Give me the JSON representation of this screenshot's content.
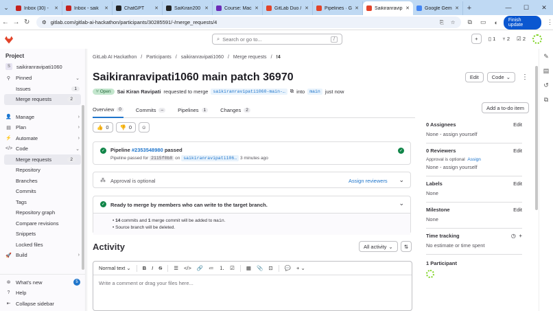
{
  "browser": {
    "tabs": [
      {
        "label": "Inbox (30) -",
        "color": "#c5221f"
      },
      {
        "label": "Inbox - saik",
        "color": "#c5221f"
      },
      {
        "label": "ChatGPT",
        "color": "#222222"
      },
      {
        "label": "SaiKiran200",
        "color": "#222222"
      },
      {
        "label": "Course: Mac",
        "color": "#6c2ab7"
      },
      {
        "label": "GitLab Duo /",
        "color": "#e24329"
      },
      {
        "label": "Pipelines · Gi",
        "color": "#e24329"
      },
      {
        "label": "Saikiranravip",
        "color": "#e24329"
      },
      {
        "label": "Google Gem",
        "color": "#4285f4"
      }
    ],
    "url": "gitlab.com/gitlab-ai-hackathon/participants/30285591/-/merge_requests/4",
    "finish_update": "Finish update"
  },
  "topbar": {
    "search_placeholder": "Search or go to...",
    "search_kbd": "/",
    "issues_count": "1",
    "mr_count": "2",
    "todo_count": "2"
  },
  "sidebar": {
    "project_heading": "Project",
    "project_initial": "S",
    "project_name": "saikiranravipati1060",
    "pinned": "Pinned",
    "pinned_items": [
      {
        "label": "Issues",
        "count": "1"
      },
      {
        "label": "Merge requests",
        "count": "2"
      }
    ],
    "groups": [
      {
        "label": "Manage",
        "icon": "manage-icon"
      },
      {
        "label": "Plan",
        "icon": "plan-icon"
      },
      {
        "label": "Automate",
        "icon": "automate-icon"
      },
      {
        "label": "Code",
        "icon": "code-icon"
      }
    ],
    "code_items": [
      {
        "label": "Merge requests",
        "count": "2"
      },
      {
        "label": "Repository"
      },
      {
        "label": "Branches"
      },
      {
        "label": "Commits"
      },
      {
        "label": "Tags"
      },
      {
        "label": "Repository graph"
      },
      {
        "label": "Compare revisions"
      },
      {
        "label": "Snippets"
      },
      {
        "label": "Locked files"
      }
    ],
    "build": "Build",
    "whats_new": "What's new",
    "whats_new_count": "5",
    "help": "Help",
    "collapse": "Collapse sidebar"
  },
  "breadcrumb": [
    "GitLab AI Hackathon",
    "Participants",
    "saikiranravipati1060",
    "Merge requests",
    "!4"
  ],
  "mr": {
    "title": "Saikiranravipati1060 main patch 36970",
    "status": "Open",
    "author": "Sai Kiran Ravipati",
    "requested_text": "requested to merge",
    "source_branch": "saikiranravipati1060-main-…",
    "into": "into",
    "target_branch": "main",
    "time": "just now",
    "edit": "Edit",
    "code": "Code"
  },
  "tabs": [
    {
      "label": "Overview",
      "count": "0"
    },
    {
      "label": "Commits",
      "count": "–"
    },
    {
      "label": "Pipelines",
      "count": "1"
    },
    {
      "label": "Changes",
      "count": "2"
    }
  ],
  "todo_button": "Add a to-do item",
  "reactions": {
    "thumbs_up": "0",
    "thumbs_down": "0"
  },
  "pipeline": {
    "label": "Pipeline",
    "id": "#2353548980",
    "status": "passed",
    "sub_prefix": "Pipeline passed for",
    "commit": "2115f0b8",
    "on": "on",
    "branch": "saikiranravipati106…",
    "time": "3 minutes ago"
  },
  "approval": {
    "text": "Approval is optional",
    "assign": "Assign reviewers"
  },
  "ready": {
    "text": "Ready to merge by members who can write to the target branch.",
    "commits_count": "14",
    "line1_mid": "commits and",
    "merge_count": "1",
    "line1_end": "merge commit will be added to",
    "target": "main",
    "line2": "Source branch will be deleted."
  },
  "activity": {
    "title": "Activity",
    "filter": "All activity"
  },
  "editor": {
    "format": "Normal text",
    "placeholder": "Write a comment or drag your files here..."
  },
  "right": {
    "assignees": {
      "label": "0 Assignees",
      "edit": "Edit",
      "value": "None - assign yourself"
    },
    "reviewers": {
      "label": "0 Reviewers",
      "edit": "Edit",
      "approval": "Approval is optional",
      "assign": "Assign",
      "value": "None - assign yourself"
    },
    "labels": {
      "label": "Labels",
      "edit": "Edit",
      "value": "None"
    },
    "milestone": {
      "label": "Milestone",
      "edit": "Edit",
      "value": "None"
    },
    "time_tracking": {
      "label": "Time tracking",
      "value": "No estimate or time spent"
    },
    "participants": {
      "label": "1 Participant"
    }
  }
}
